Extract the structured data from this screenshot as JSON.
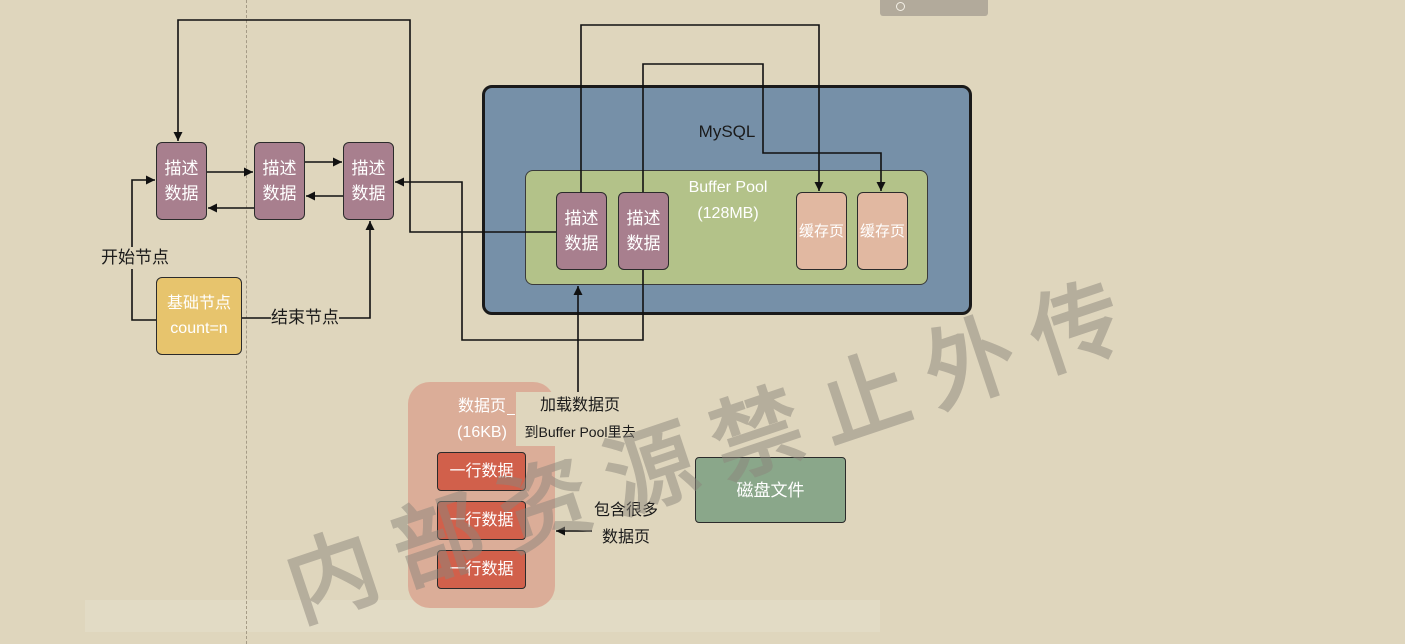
{
  "mysql": {
    "title": "MySQL",
    "buffer_pool": {
      "title": "Buffer Pool",
      "size": "(128MB)",
      "descriptor_blocks": [
        {
          "line1": "描述",
          "line2": "数据"
        },
        {
          "line1": "描述",
          "line2": "数据"
        }
      ],
      "cache_pages": [
        "缓存页",
        "缓存页"
      ]
    }
  },
  "free_list": {
    "descriptor_blocks": [
      {
        "line1": "描述",
        "line2": "数据"
      },
      {
        "line1": "描述",
        "line2": "数据"
      },
      {
        "line1": "描述",
        "line2": "数据"
      }
    ],
    "base_node": {
      "line1": "基础节点",
      "line2": "count=n"
    },
    "start_label": "开始节点",
    "end_label": "结束节点"
  },
  "data_page": {
    "title": "数据页",
    "size": "(16KB)",
    "rows": [
      "一行数据",
      "一行数据",
      "一行数据"
    ],
    "load_label": {
      "line1": "加载数据页",
      "line2": "到Buffer Pool里去"
    }
  },
  "disk_file": {
    "label": "磁盘文件",
    "contains_label": {
      "line1": "包含很多",
      "line2": "数据页"
    }
  },
  "watermark": "内部资源禁止外传",
  "icons": {
    "toolbar_button": "circle-icon"
  },
  "colors": {
    "background": "#dfd6bd",
    "mysql_fill": "#7690a8",
    "buffer_pool_fill": "#b3c289",
    "descriptor_fill": "#a87f8e",
    "cache_page_fill": "#e1b8a1",
    "base_node_fill": "#e7c46d",
    "data_page_fill": "#dbad98",
    "row_fill": "#d1604b",
    "disk_file_fill": "#8aa78a",
    "line": "#111111",
    "watermark": "rgba(140,134,124,0.5)"
  }
}
